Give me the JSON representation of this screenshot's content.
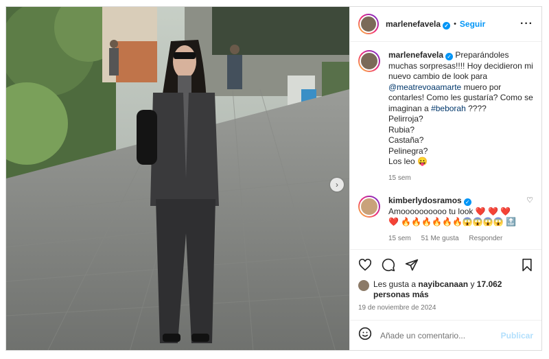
{
  "post": {
    "username": "marlenefavela",
    "follow_label": "Seguir",
    "more_icon": "more-horizontal-icon",
    "caption": {
      "intro": "Preparándoles muchas sorpresas!!!! Hoy decidieron mi nuevo cambio de look para",
      "mention": "@meatrevoaamarte",
      "middle": "muero por contarles! Como les gustaría? Como se imaginan a",
      "hashtag": "#beborah",
      "tail": "????",
      "lines": [
        "Pelirroja?",
        "Rubia?",
        "Castaña?",
        "Pelinegra?",
        "Los leo 😛"
      ],
      "time": "15 sem"
    }
  },
  "comment": {
    "username": "kimberlydosramos",
    "text": "Amoooooooooo tu look ❤️ ❤️ ❤️ ❤️ 🔥🔥🔥🔥🔥🔥😱😱😱😱 🔝",
    "time": "15 sem",
    "likes": "51 Me gusta",
    "reply": "Responder"
  },
  "likes": {
    "prefix": "Les gusta a",
    "user": "nayibcanaan",
    "connector": "y",
    "count": "17.062 personas más"
  },
  "date": "19 de noviembre de 2024",
  "add_comment": {
    "placeholder": "Añade un comentario...",
    "post_label": "Publicar"
  },
  "colors": {
    "accent": "#0095f6",
    "link": "#00376b",
    "muted": "#737373",
    "border": "#dbdbdb"
  }
}
